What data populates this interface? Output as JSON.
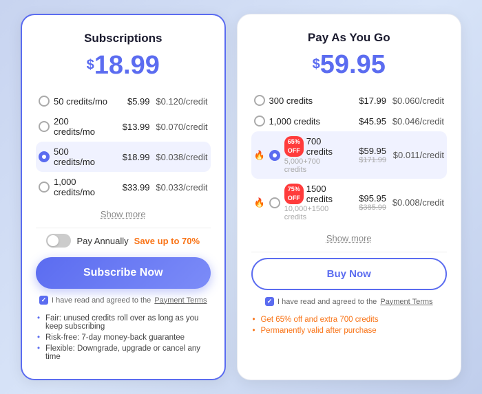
{
  "subscriptions": {
    "title": "Subscriptions",
    "price_dollar": "$",
    "price_amount": "18.99",
    "options": [
      {
        "id": 1,
        "credits": "50 credits/mo",
        "price": "$5.99",
        "per_credit": "$0.120/credit",
        "selected": false
      },
      {
        "id": 2,
        "credits": "200 credits/mo",
        "price": "$13.99",
        "per_credit": "$0.070/credit",
        "selected": false
      },
      {
        "id": 3,
        "credits": "500 credits/mo",
        "price": "$18.99",
        "per_credit": "$0.038/credit",
        "selected": true
      },
      {
        "id": 4,
        "credits": "1,000 credits/mo",
        "price": "$33.99",
        "per_credit": "$0.033/credit",
        "selected": false
      }
    ],
    "show_more": "Show more",
    "toggle_label": "Pay Annually",
    "save_text": "Save up to 70%",
    "subscribe_btn": "Subscribe Now",
    "terms_text": "I have read and agreed to the",
    "terms_link": "Payment Terms",
    "bullets": [
      "Fair: unused credits roll over as long as you keep subscribing",
      "Risk-free: 7-day money-back guarantee",
      "Flexible: Downgrade, upgrade or cancel any time"
    ]
  },
  "payasyougo": {
    "title": "Pay As You Go",
    "price_dollar": "$",
    "price_amount": "59.95",
    "options": [
      {
        "id": 1,
        "credits": "300 credits",
        "price": "$17.99",
        "per_credit": "$0.060/credit",
        "has_badge": false,
        "has_fire": false,
        "selected": false
      },
      {
        "id": 2,
        "credits": "1,000 credits",
        "price": "$45.95",
        "per_credit": "$0.046/credit",
        "has_badge": false,
        "has_fire": false,
        "selected": false
      },
      {
        "id": 3,
        "credits": "700 credits",
        "credits_bonus": "5,000+700 credits",
        "badge": "65% OFF",
        "price": "$59.95",
        "price_strike": "$171.99",
        "per_credit": "$0.011/credit",
        "has_badge": true,
        "has_fire": true,
        "selected": true
      },
      {
        "id": 4,
        "credits": "1500 credits",
        "credits_bonus": "10,000+1500 credits",
        "badge": "75% OFF",
        "price": "$95.95",
        "price_strike": "$385.99",
        "per_credit": "$0.008/credit",
        "has_badge": true,
        "has_fire": true,
        "selected": false
      }
    ],
    "show_more": "Show more",
    "buy_btn": "Buy Now",
    "terms_text": "I have read and agreed to the",
    "terms_link": "Payment Terms",
    "promo_bullets": [
      "Get 65% off and extra 700 credits",
      "Permanently valid after purchase"
    ]
  }
}
